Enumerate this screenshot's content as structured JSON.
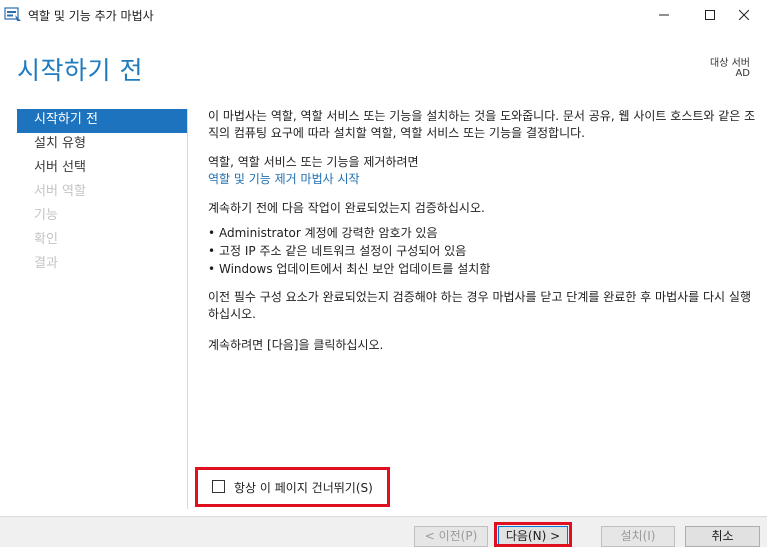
{
  "window": {
    "title": "역할 및 기능 추가 마법사",
    "icon": "server-manager-icon"
  },
  "header": {
    "page_title": "시작하기 전",
    "target_label": "대상 서버",
    "target_value": "AD"
  },
  "nav": {
    "items": [
      {
        "label": "시작하기 전",
        "state": "active"
      },
      {
        "label": "설치 유형",
        "state": "enabled"
      },
      {
        "label": "서버 선택",
        "state": "enabled"
      },
      {
        "label": "서버 역할",
        "state": "disabled"
      },
      {
        "label": "기능",
        "state": "disabled"
      },
      {
        "label": "확인",
        "state": "disabled"
      },
      {
        "label": "결과",
        "state": "disabled"
      }
    ]
  },
  "content": {
    "intro": "이 마법사는 역할, 역할 서비스 또는 기능을 설치하는 것을 도와줍니다. 문서 공유, 웹 사이트 호스트와 같은 조직의 컴퓨팅 요구에 따라 설치할 역할, 역할 서비스 또는 기능을 결정합니다.",
    "remove_text": "역할, 역할 서비스 또는 기능을 제거하려면",
    "remove_link": "역할 및 기능 제거 마법사 시작",
    "verify_text": "계속하기 전에 다음 작업이 완료되었는지 검증하십시오.",
    "bullets": [
      "Administrator 계정에 강력한 암호가 있음",
      "고정 IP 주소 같은 네트워크 설정이 구성되어 있음",
      "Windows 업데이트에서 최신 보안 업데이트를 설치함"
    ],
    "prereq_text": "이전 필수 구성 요소가 완료되었는지 검증해야 하는 경우 마법사를 닫고 단계를 완료한 후 마법사를 다시 실행하십시오.",
    "next_text": "계속하려면 [다음]을 클릭하십시오."
  },
  "skip": {
    "label": "항상 이 페이지 건너뛰기(S)",
    "checked": false
  },
  "footer": {
    "prev_label": "< 이전(P)",
    "next_label": "다음(N) >",
    "install_label": "설치(I)",
    "cancel_label": "취소"
  },
  "colors": {
    "accent": "#1e73be",
    "title": "#1f7bbf",
    "link": "#1f6fb2",
    "highlight": "#e01020"
  }
}
